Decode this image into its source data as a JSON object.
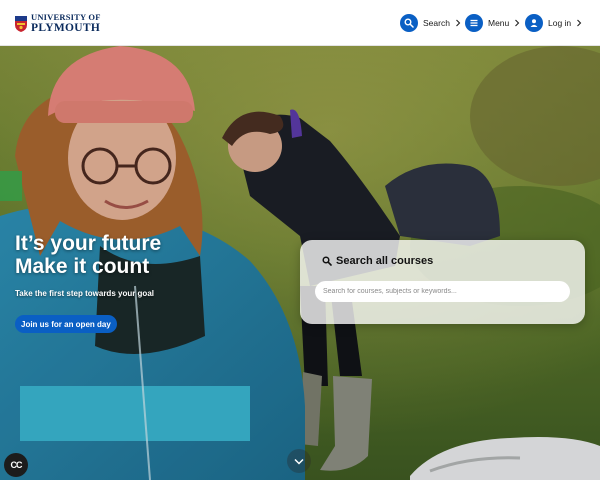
{
  "header": {
    "logo": {
      "line1": "UNIVERSITY OF",
      "line2": "PLYMOUTH"
    },
    "nav": {
      "search_label": "Search",
      "menu_label": "Menu",
      "login_label": "Log in"
    }
  },
  "hero": {
    "headline_line1": "It’s your future",
    "headline_line2": "Make it count",
    "subheading": "Take the first step towards your goal",
    "cta_label": "Join us for an open day"
  },
  "course_search": {
    "title": "Search all courses",
    "placeholder": "Search for courses, subjects or keywords...",
    "value": ""
  },
  "controls": {
    "captions_label": "CC"
  },
  "colors": {
    "brand_blue": "#0a5fc4",
    "navy": "#0a2a5c",
    "header_bg": "#ffffff"
  },
  "icons": [
    "crest-icon",
    "search-icon",
    "menu-icon",
    "user-icon",
    "chevron-right-icon",
    "chevron-down-icon",
    "captions-icon"
  ]
}
